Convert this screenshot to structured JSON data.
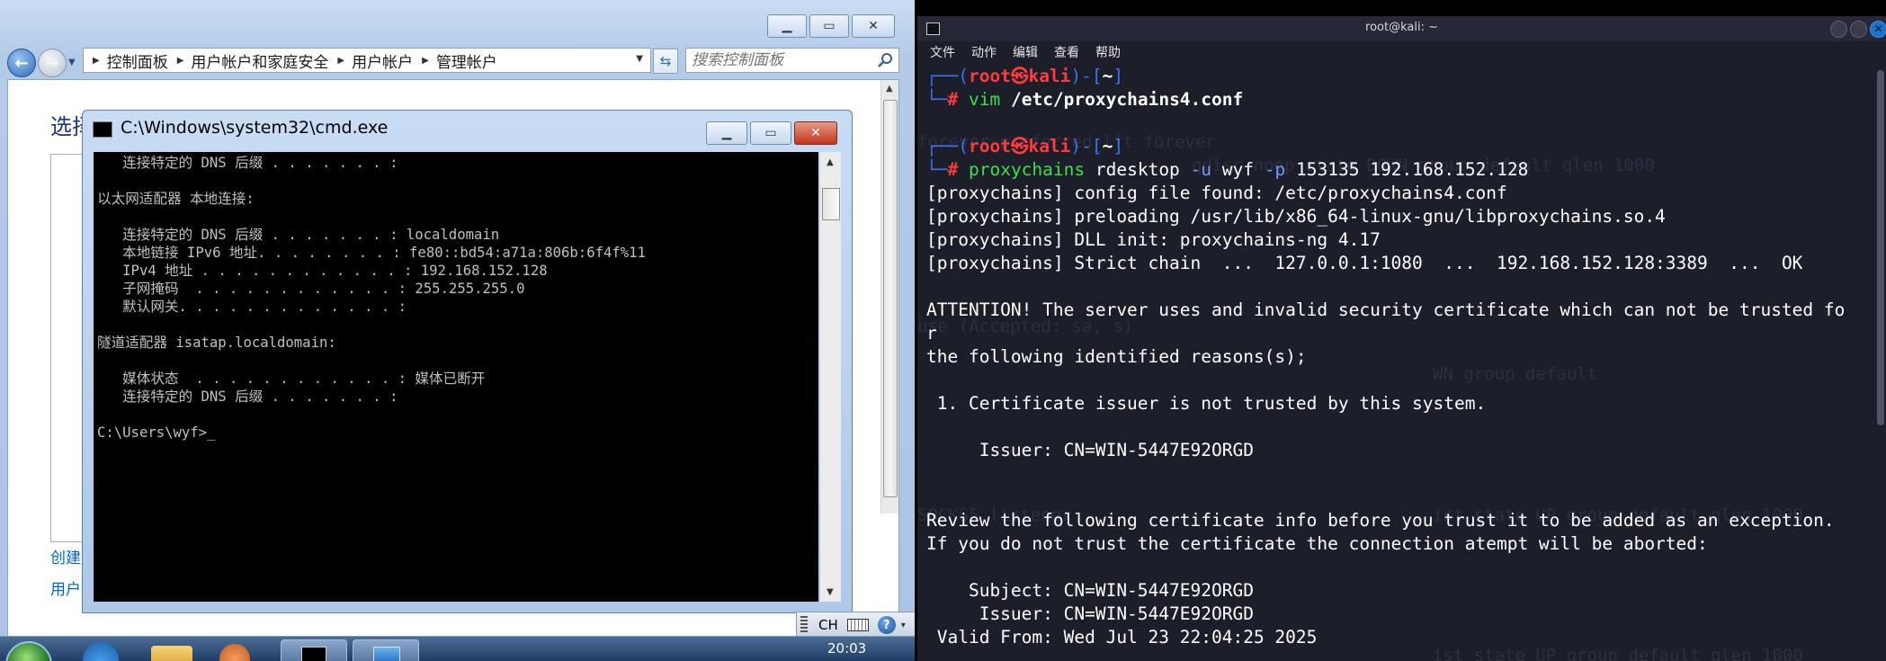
{
  "win7": {
    "breadcrumb": [
      "控制面板",
      "用户帐户和家庭安全",
      "用户帐户",
      "管理帐户"
    ],
    "search_placeholder": "搜索控制面板",
    "heading_partial": "选择",
    "link1_partial": "创建",
    "link2_partial": "用户",
    "clock": "20:03",
    "langbar": {
      "label": "CH"
    }
  },
  "cmd": {
    "title": "C:\\Windows\\system32\\cmd.exe",
    "lines": [
      "   连接特定的 DNS 后缀 . . . . . . . :",
      "",
      "以太网适配器 本地连接:",
      "",
      "   连接特定的 DNS 后缀 . . . . . . . : localdomain",
      "   本地链接 IPv6 地址. . . . . . . . : fe80::bd54:a71a:806b:6f4f%11",
      "   IPv4 地址 . . . . . . . . . . . . : 192.168.152.128",
      "   子网掩码  . . . . . . . . . . . . : 255.255.255.0",
      "   默认网关. . . . . . . . . . . . . :",
      "",
      "隧道适配器 isatap.localdomain:",
      "",
      "   媒体状态  . . . . . . . . . . . . : 媒体已断开",
      "   连接特定的 DNS 后缀 . . . . . . . :",
      "",
      "C:\\Users\\wyf>_"
    ]
  },
  "kali": {
    "window_title": "root@kali: ~",
    "menu": [
      "文件",
      "动作",
      "编辑",
      "查看",
      "帮助"
    ],
    "prompt": {
      "user": "root",
      "host": "kali",
      "cwd": "~"
    },
    "cmd1": {
      "program": "vim",
      "args": "/etc/proxychains4.conf"
    },
    "cmd2": {
      "program": "proxychains",
      "text": "rdesktop -u wyf -p 153135 192.168.152.128"
    },
    "output": [
      "[proxychains] config file found: /etc/proxychains4.conf",
      "[proxychains] preloading /usr/lib/x86_64-linux-gnu/libproxychains.so.4",
      "[proxychains] DLL init: proxychains-ng 4.17",
      "[proxychains] Strict chain  ...  127.0.0.1:1080  ...  192.168.152.128:3389  ...  OK",
      "",
      "ATTENTION! The server uses and invalid security certificate which can not be trusted fo",
      "r",
      "the following identified reasons(s);",
      "",
      " 1. Certificate issuer is not trusted by this system.",
      "",
      "     Issuer: CN=WIN-5447E92ORGD",
      "",
      "",
      "Review the following certificate info before you trust it to be added as an exception.",
      "If you do not trust the certificate the connection atempt will be aborted:",
      "",
      "    Subject: CN=WIN-5447E92ORGD",
      "     Issuer: CN=WIN-5447E92ORGD",
      " Valid From: Wed Jul 23 22:04:25 2025"
    ],
    "ghost_text": [
      "forever preferred_lft forever",
      "qdisc noop state DOWN group default qlen 1000",
      "use (Accepted: sa, s)",
      "WN group default",
      "SOCKS5 listener",
      "ist state UP group default qlen 1000",
      "ist state UP group default qlen 1000"
    ]
  }
}
